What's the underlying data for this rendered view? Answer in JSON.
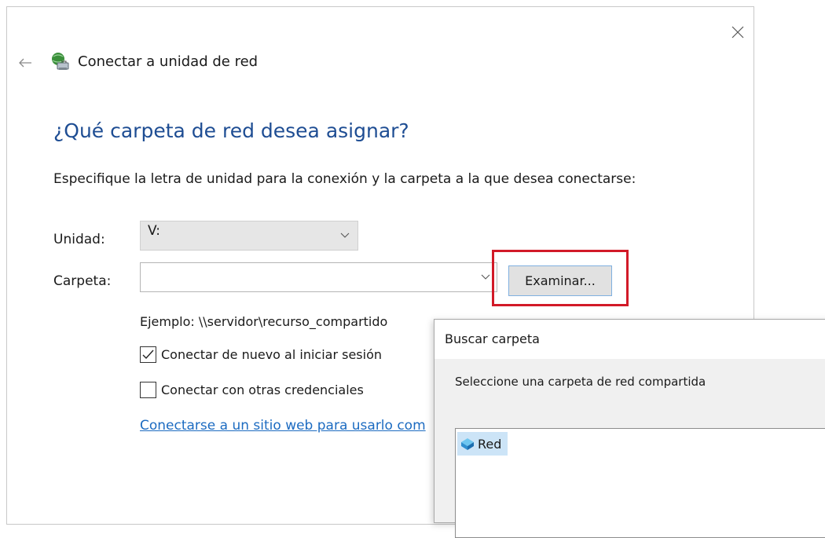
{
  "wizard": {
    "title": "Conectar a unidad de red",
    "heading": "¿Qué carpeta de red desea asignar?",
    "instruction": "Especifique la letra de unidad para la conexión y la carpeta a la que desea conectarse:",
    "drive_label": "Unidad:",
    "drive_value": "V:",
    "folder_label": "Carpeta:",
    "folder_value": "",
    "browse_label": "Examinar...",
    "example": "Ejemplo: \\\\servidor\\recurso_compartido",
    "reconnect_label": "Conectar de nuevo al iniciar sesión",
    "reconnect_checked": true,
    "credentials_label": "Conectar con otras credenciales",
    "credentials_checked": false,
    "link_text": "Conectarse a un sitio web para usarlo com"
  },
  "browse_dialog": {
    "title": "Buscar carpeta",
    "prompt": "Seleccione una carpeta de red compartida",
    "tree_items": [
      {
        "label": "Red",
        "icon": "network-icon",
        "selected": true
      }
    ]
  },
  "icons": {
    "close": "close-icon",
    "back": "back-arrow-icon",
    "app": "network-drive-icon",
    "dropdown": "chevron-down-icon"
  },
  "colors": {
    "heading": "#1e4d93",
    "link": "#1c6bc1",
    "highlight_box": "#d21a28",
    "selection": "#cce4f7"
  }
}
